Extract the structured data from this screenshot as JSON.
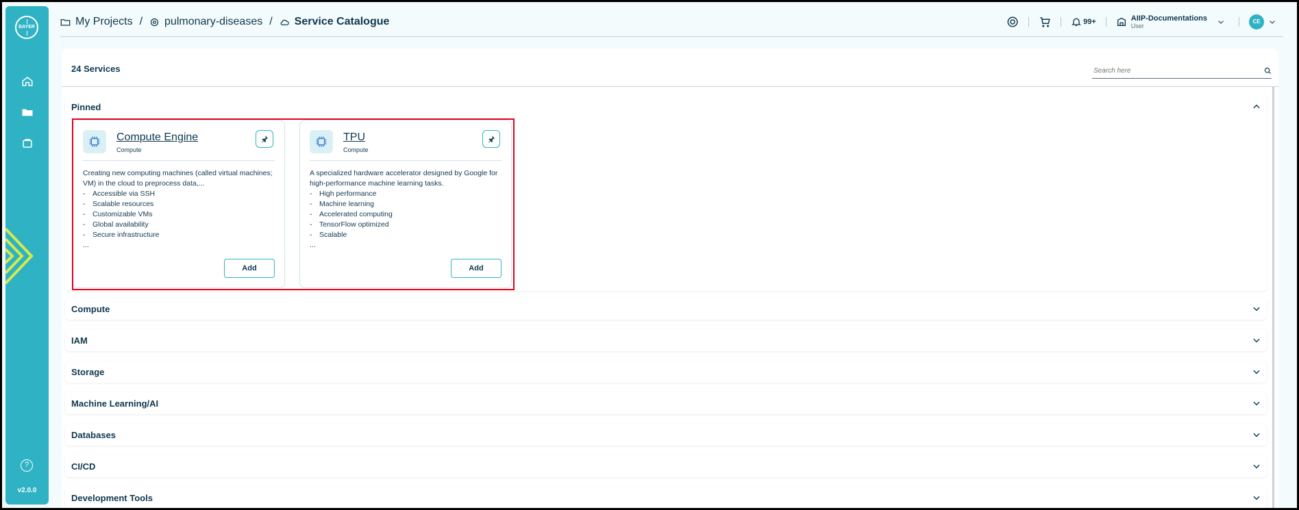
{
  "sidebar": {
    "logo_text": "BAYER",
    "items": [
      {
        "icon": "home-icon"
      },
      {
        "icon": "folder-icon"
      },
      {
        "icon": "bag-icon"
      }
    ],
    "help_icon": "?",
    "version": "v2.0.0"
  },
  "breadcrumb": {
    "items": [
      {
        "label": "My Projects",
        "icon": "folder-icon"
      },
      {
        "label": "pulmonary-diseases",
        "icon": "gear-icon"
      },
      {
        "label": "Service Catalogue",
        "icon": "cloud-icon"
      }
    ],
    "separator": "/"
  },
  "topbar": {
    "notifications_count": "99+",
    "account_name": "AIIP-Documentations",
    "account_role": "User",
    "avatar_initials": "CE"
  },
  "main": {
    "services_count": "24 Services",
    "search_placeholder": "Search here",
    "sections": [
      {
        "title": "Pinned",
        "expanded": true
      },
      {
        "title": "Compute"
      },
      {
        "title": "IAM"
      },
      {
        "title": "Storage"
      },
      {
        "title": "Machine Learning/AI"
      },
      {
        "title": "Databases"
      },
      {
        "title": "CI/CD"
      },
      {
        "title": "Development Tools"
      }
    ],
    "cards": [
      {
        "title": "Compute Engine",
        "category": "Compute",
        "description": "Creating new computing machines (called virtual machines; VM) in the cloud to preprocess data,...",
        "features": [
          "Accessible via SSH",
          "Scalable resources",
          "Customizable VMs",
          "Global availability",
          "Secure infrastructure"
        ],
        "ellipsis": "...",
        "button": "Add"
      },
      {
        "title": "TPU",
        "category": "Compute",
        "description": "A specialized hardware accelerator designed by Google for high-performance machine learning tasks.",
        "features": [
          "High performance",
          "Machine learning",
          "Accelerated computing",
          "TensorFlow optimized",
          "Scalable"
        ],
        "ellipsis": "...",
        "button": "Add"
      }
    ]
  },
  "colors": {
    "accent": "#2fb3c4",
    "text": "#10384f",
    "highlight": "#e3001b"
  }
}
